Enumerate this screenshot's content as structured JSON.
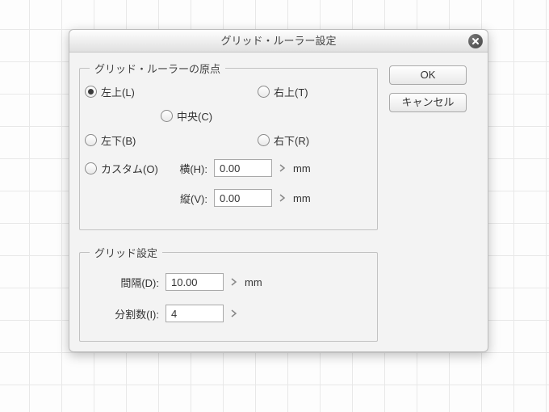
{
  "dialog": {
    "title": "グリッド・ルーラー設定"
  },
  "buttons": {
    "ok": "OK",
    "cancel": "キャンセル"
  },
  "origin": {
    "legend": "グリッド・ルーラーの原点",
    "selected": "top_left",
    "options": {
      "top_left": "左上(L)",
      "top_right": "右上(T)",
      "center": "中央(C)",
      "bottom_left": "左下(B)",
      "bottom_right": "右下(R)",
      "custom": "カスタム(O)"
    },
    "custom_fields": {
      "h_label": "横(H):",
      "h_value": "0.00",
      "h_unit": "mm",
      "v_label": "縦(V):",
      "v_value": "0.00",
      "v_unit": "mm"
    }
  },
  "grid": {
    "legend": "グリッド設定",
    "spacing_label": "間隔(D):",
    "spacing_value": "10.00",
    "spacing_unit": "mm",
    "division_label": "分割数(I):",
    "division_value": "4"
  }
}
